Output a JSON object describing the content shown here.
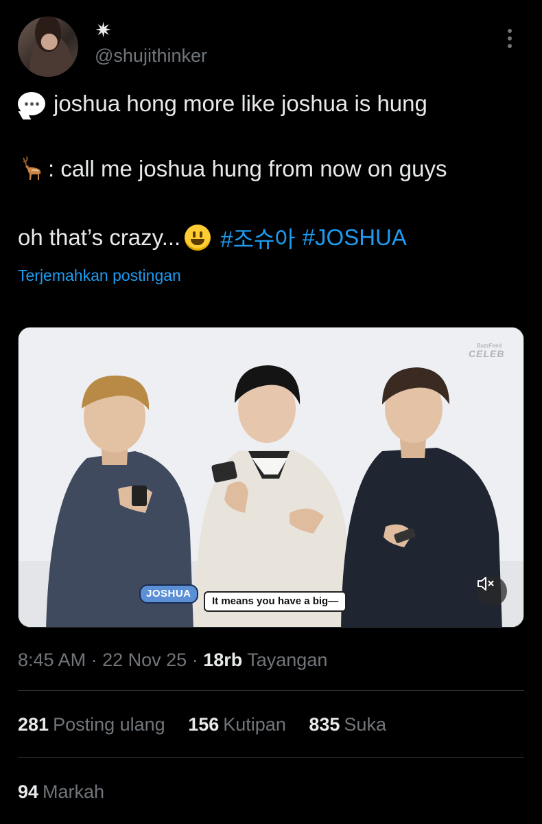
{
  "author": {
    "display_name": "✷",
    "handle": "@shujithinker"
  },
  "post": {
    "line1": "joshua hong more like joshua is hung",
    "line2": ": call me joshua hung from now on guys",
    "line3": "oh that’s crazy...",
    "hashtags": [
      "#조슈아",
      "#JOSHUA"
    ],
    "translate_label": "Terjemahkan postingan"
  },
  "media": {
    "watermark_small": "BuzzFeed",
    "watermark": "CELEB",
    "caption_name": "JOSHUA",
    "caption_text": "It means you have a big—"
  },
  "meta": {
    "time": "8:45 AM",
    "date": "22 Nov 25",
    "views_count": "18rb",
    "views_label": "Tayangan"
  },
  "stats": {
    "reposts": {
      "count": "281",
      "label": "Posting ulang"
    },
    "quotes": {
      "count": "156",
      "label": "Kutipan"
    },
    "likes": {
      "count": "835",
      "label": "Suka"
    },
    "bookmarks": {
      "count": "94",
      "label": "Markah"
    }
  },
  "icons": {
    "speech": "speech-balloon-icon",
    "deer": "deer-icon",
    "smile": "smiling-face-icon",
    "mute": "speaker-muted-icon",
    "more": "more-vertical-icon"
  },
  "colors": {
    "background": "#000000",
    "text": "#e7e9ea",
    "secondary": "#71767b",
    "link": "#1d9bf0",
    "divider": "#2f3336"
  }
}
